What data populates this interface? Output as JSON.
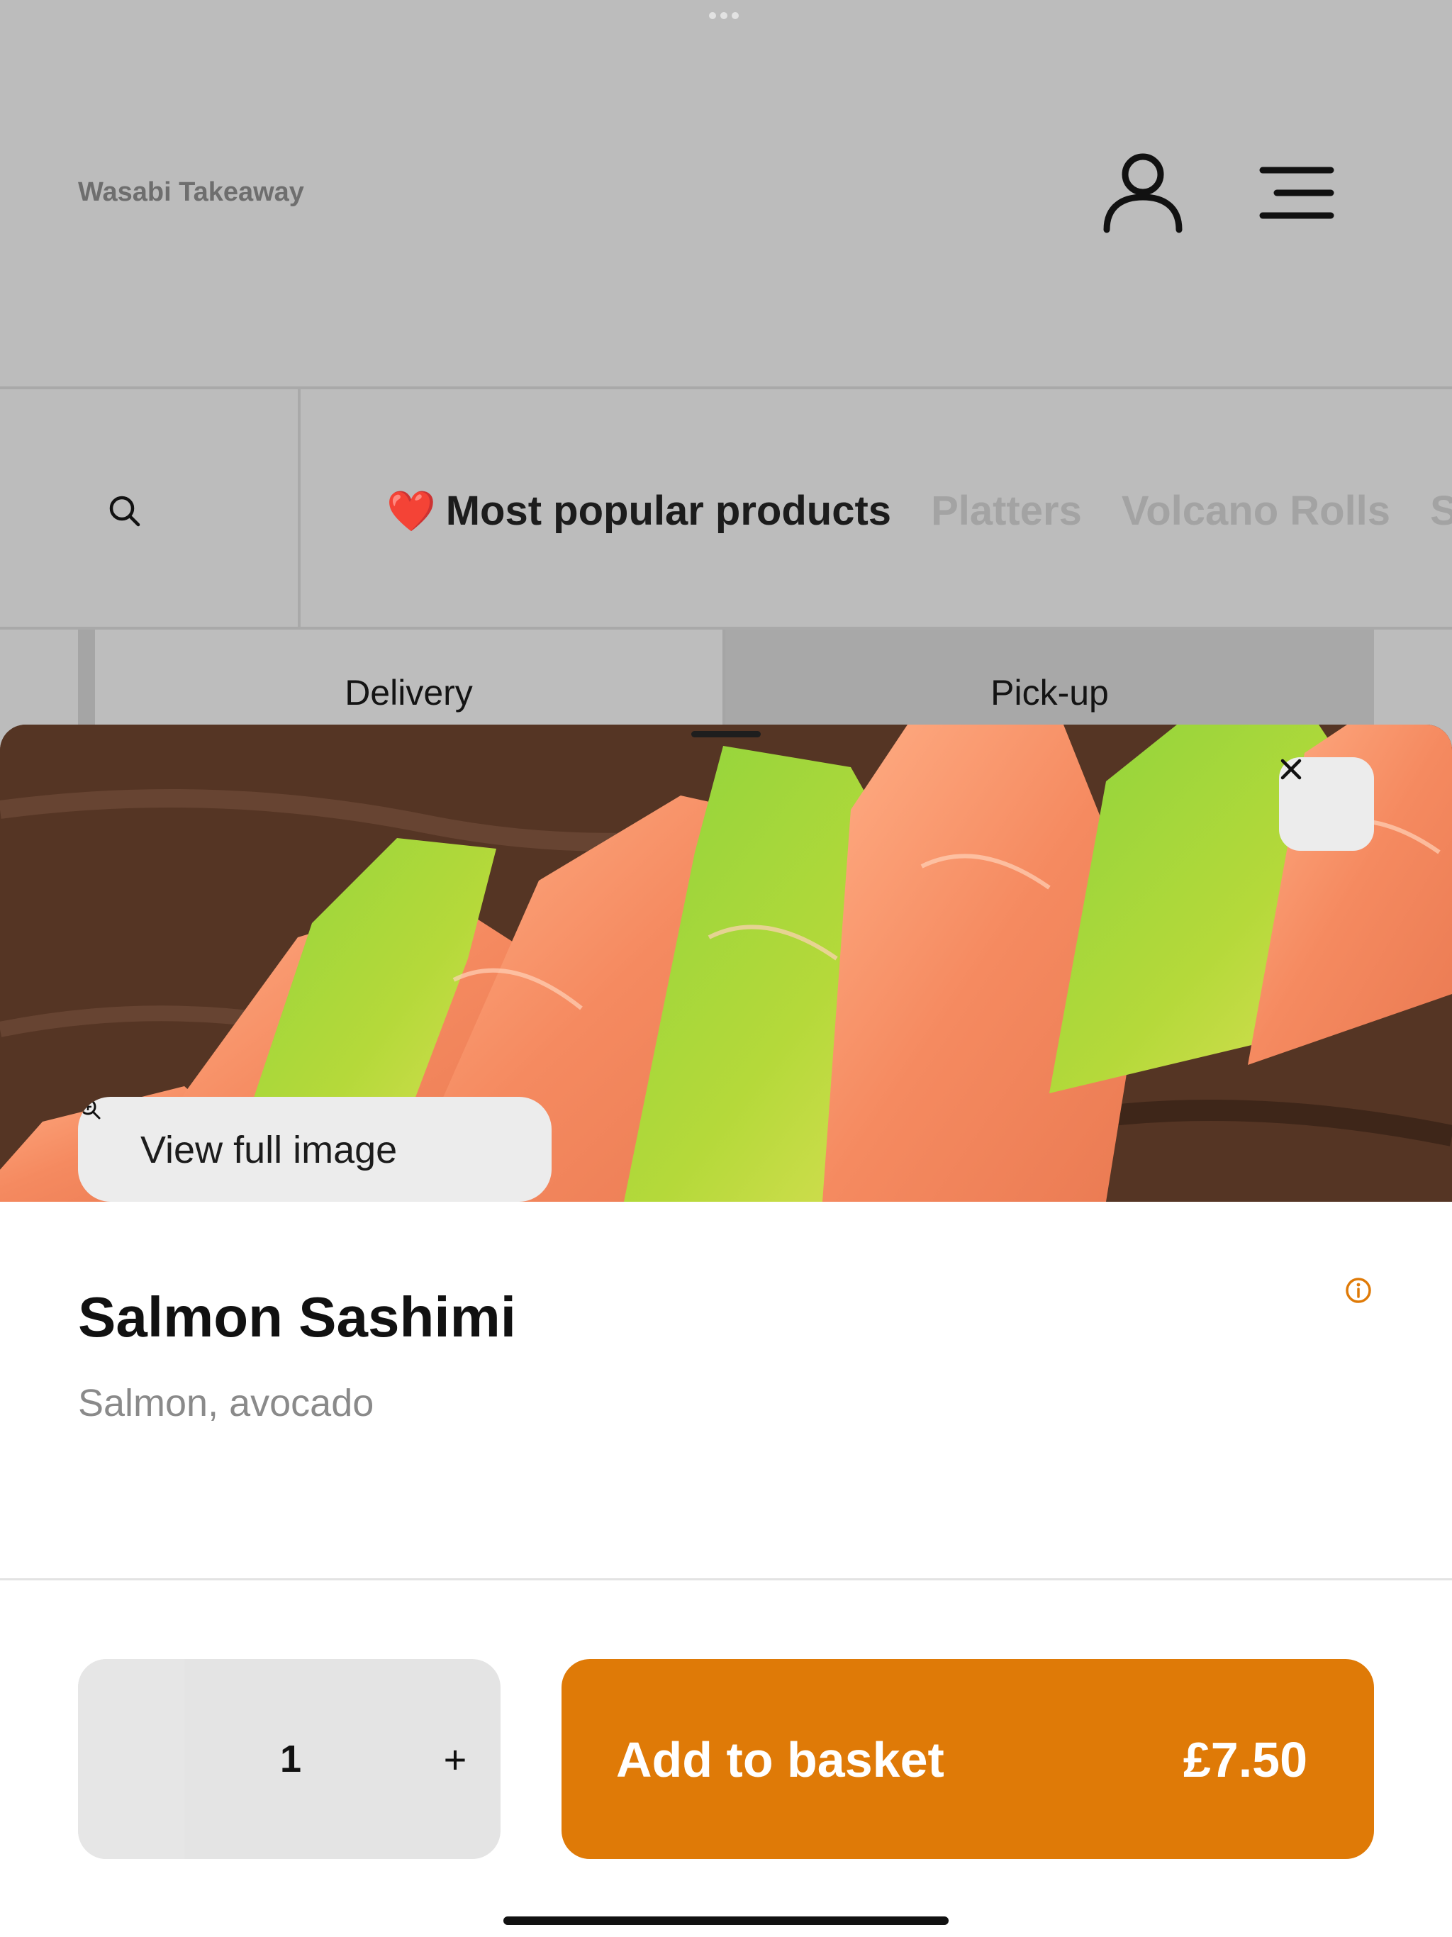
{
  "header": {
    "brand": "Wasabi Takeaway",
    "account_icon": "person-icon",
    "menu_icon": "hamburger-menu-icon"
  },
  "categories": {
    "search_icon": "search-icon",
    "tabs": [
      {
        "label": "Most popular products",
        "emoji": "❤️",
        "active": true
      },
      {
        "label": "Platters",
        "active": false
      },
      {
        "label": "Volcano Rolls",
        "active": false
      },
      {
        "label": "S",
        "active": false
      }
    ]
  },
  "order_mode": {
    "options": [
      "Delivery",
      "Pick-up"
    ],
    "selected": "Pick-up"
  },
  "product": {
    "view_full_image_label": "View full image",
    "close_icon": "close-icon",
    "zoom_icon": "zoom-in-icon",
    "info_icon": "info-icon",
    "title": "Salmon Sashimi",
    "description": "Salmon, avocado",
    "quantity": "1",
    "increment_label": "+",
    "add_to_basket_label": "Add to basket",
    "price": "£7.50"
  },
  "colors": {
    "accent": "#df7a07",
    "overlay": "#bcbcbc",
    "heart": "#c8102e"
  }
}
